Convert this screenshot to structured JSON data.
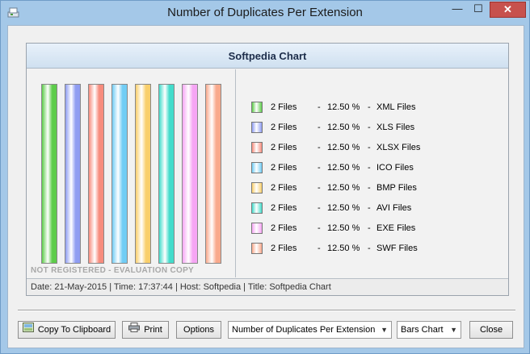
{
  "window": {
    "title": "Number of Duplicates Per Extension",
    "minimize_glyph": "—",
    "maximize_glyph": "☐",
    "close_glyph": "✕"
  },
  "chart": {
    "header": "Softpedia Chart",
    "watermark": "NOT REGISTERED - EVALUATION COPY",
    "status": "Date: 21-May-2015 | Time: 17:37:44 | Host: Softpedia | Title: Softpedia Chart"
  },
  "legend": [
    {
      "files": "2 Files",
      "sep1": "-",
      "pct": "12.50 %",
      "sep2": "-",
      "ext": "XML Files",
      "color": "#5dcc4a"
    },
    {
      "files": "2 Files",
      "sep1": "-",
      "pct": "12.50 %",
      "sep2": "-",
      "ext": "XLS Files",
      "color": "#8f9df2"
    },
    {
      "files": "2 Files",
      "sep1": "-",
      "pct": "12.50 %",
      "sep2": "-",
      "ext": "XLSX Files",
      "color": "#f78c7d"
    },
    {
      "files": "2 Files",
      "sep1": "-",
      "pct": "12.50 %",
      "sep2": "-",
      "ext": "ICO Files",
      "color": "#71cdf5"
    },
    {
      "files": "2 Files",
      "sep1": "-",
      "pct": "12.50 %",
      "sep2": "-",
      "ext": "BMP Files",
      "color": "#f9cf6b"
    },
    {
      "files": "2 Files",
      "sep1": "-",
      "pct": "12.50 %",
      "sep2": "-",
      "ext": "AVI Files",
      "color": "#43dccb"
    },
    {
      "files": "2 Files",
      "sep1": "-",
      "pct": "12.50 %",
      "sep2": "-",
      "ext": "EXE Files",
      "color": "#f6a5f4"
    },
    {
      "files": "2 Files",
      "sep1": "-",
      "pct": "12.50 %",
      "sep2": "-",
      "ext": "SWF Files",
      "color": "#f9a98c"
    }
  ],
  "chart_data": {
    "type": "bar",
    "categories": [
      "XML Files",
      "XLS Files",
      "XLSX Files",
      "ICO Files",
      "BMP Files",
      "AVI Files",
      "EXE Files",
      "SWF Files"
    ],
    "values": [
      2,
      2,
      2,
      2,
      2,
      2,
      2,
      2
    ],
    "percentages": [
      12.5,
      12.5,
      12.5,
      12.5,
      12.5,
      12.5,
      12.5,
      12.5
    ],
    "colors": [
      "#5dcc4a",
      "#8f9df2",
      "#f78c7d",
      "#71cdf5",
      "#f9cf6b",
      "#43dccb",
      "#f6a5f4",
      "#f9a98c"
    ],
    "title": "Softpedia Chart",
    "grid": false,
    "legend_position": "right"
  },
  "buttons": {
    "copy": "Copy To Clipboard",
    "print": "Print",
    "options": "Options",
    "close": "Close"
  },
  "selects": {
    "extension_view": "Number of Duplicates Per Extension",
    "chart_type": "Bars Chart"
  },
  "icons": {
    "app": "app-icon",
    "copy": "clipboard-icon",
    "print": "printer-icon"
  }
}
